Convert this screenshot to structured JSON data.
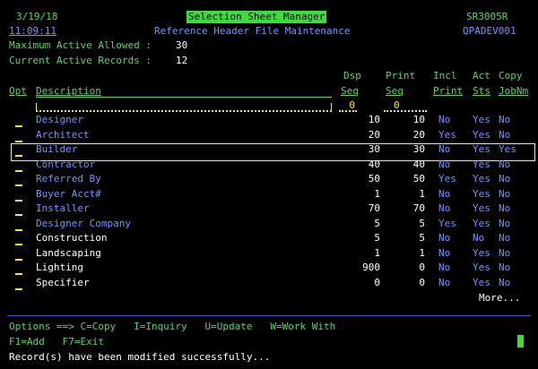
{
  "header": {
    "date": "3/19/18",
    "time": "11:09:11",
    "title": "Selection Sheet Manager",
    "subtitle": "Reference Header File Maintenance",
    "program": "SR3005R",
    "device": "QPADEV001"
  },
  "info": {
    "max_active_label": "Maximum Active Allowed :",
    "max_active_value": "30",
    "current_active_label": "Current Active Records :",
    "current_active_value": "12"
  },
  "columns": {
    "opt": "Opt",
    "description": "Description",
    "dsp_top": "Dsp",
    "dsp_bottom": "Seq",
    "print_top": "Print",
    "print_bottom": "Seq",
    "incl_top": "Incl",
    "incl_bottom": "Print",
    "act_top": "Act",
    "act_bottom": "Sts",
    "copy_top": "Copy",
    "copy_bottom": "JobNm"
  },
  "filter": {
    "description": "",
    "dsp_seq": "0",
    "print_seq": "0"
  },
  "rows": [
    {
      "description": "Designer",
      "dsp": "10",
      "print": "10",
      "incl": "No",
      "act": "Yes",
      "copy": "No",
      "color": "blue"
    },
    {
      "description": "Architect",
      "dsp": "20",
      "print": "20",
      "incl": "Yes",
      "act": "Yes",
      "copy": "No",
      "color": "blue"
    },
    {
      "description": "Builder",
      "dsp": "30",
      "print": "30",
      "incl": "No",
      "act": "Yes",
      "copy": "Yes",
      "color": "blue"
    },
    {
      "description": "Contractor",
      "dsp": "40",
      "print": "40",
      "incl": "No",
      "act": "Yes",
      "copy": "No",
      "color": "blue"
    },
    {
      "description": "Referred By",
      "dsp": "50",
      "print": "50",
      "incl": "Yes",
      "act": "Yes",
      "copy": "No",
      "color": "blue"
    },
    {
      "description": "Buyer Acct#",
      "dsp": "1",
      "print": "1",
      "incl": "No",
      "act": "Yes",
      "copy": "No",
      "color": "blue"
    },
    {
      "description": "Installer",
      "dsp": "70",
      "print": "70",
      "incl": "No",
      "act": "Yes",
      "copy": "No",
      "color": "blue"
    },
    {
      "description": "Designer Company",
      "dsp": "5",
      "print": "5",
      "incl": "Yes",
      "act": "Yes",
      "copy": "No",
      "color": "blue"
    },
    {
      "description": "Construction",
      "dsp": "5",
      "print": "5",
      "incl": "No",
      "act": "No",
      "copy": "No",
      "color": "white"
    },
    {
      "description": "Landscaping",
      "dsp": "1",
      "print": "1",
      "incl": "No",
      "act": "Yes",
      "copy": "No",
      "color": "white"
    },
    {
      "description": "Lighting",
      "dsp": "900",
      "print": "0",
      "incl": "No",
      "act": "Yes",
      "copy": "No",
      "color": "white"
    },
    {
      "description": "Specifier",
      "dsp": "0",
      "print": "0",
      "incl": "No",
      "act": "Yes",
      "copy": "No",
      "color": "white"
    }
  ],
  "more": "More...",
  "footer": {
    "options": "Options ==> C=Copy   I=Inquiry   U=Update   W=Work With",
    "keys": "F1=Add   F7=Exit",
    "message": "Record(s) have been modified successfully..."
  },
  "colors": {
    "green": "#55d36a",
    "blue": "#6f94ff",
    "white": "#ffffff",
    "yellow": "#f2e64a",
    "title_bg": "#3ddc3d"
  }
}
